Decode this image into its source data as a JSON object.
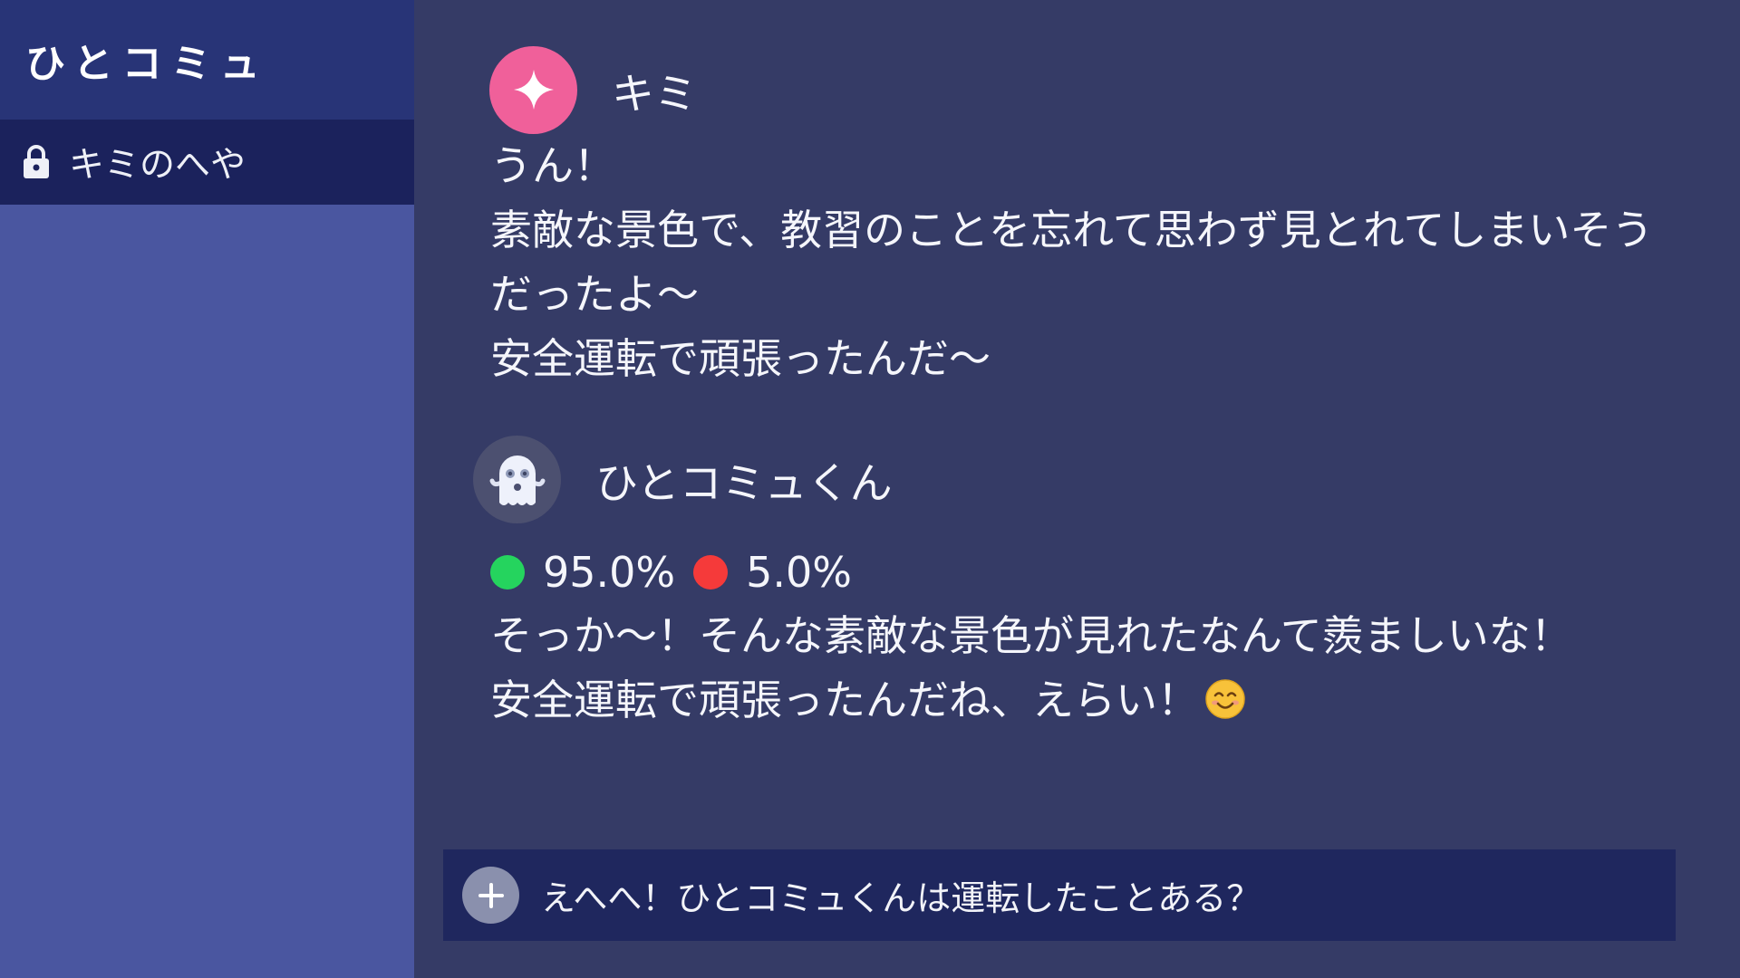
{
  "app": {
    "brand": "ひとコミュ"
  },
  "sidebar": {
    "channels": [
      {
        "label": "キミのへや",
        "icon": "lock-icon",
        "selected": true
      }
    ]
  },
  "messages": [
    {
      "author": "キミ",
      "avatar_icon": "sparkle-icon",
      "avatar_color": "#f0609a",
      "lines": [
        "うん！",
        "素敵な景色で、教習のことを忘れて思わず見とれてしまいそう",
        "だったよ〜",
        "安全運転で頑張ったんだ〜"
      ]
    },
    {
      "author": "ひとコミュくん",
      "avatar_icon": "ghost-icon",
      "avatar_color": "#4c5070",
      "scores": {
        "positive": "95.0%",
        "negative": "5.0%",
        "positive_color": "#25d45e",
        "negative_color": "#f53a3a"
      },
      "lines": [
        "そっか〜！そんな素敵な景色が見れたなんて羨ましいな！",
        "安全運転で頑張ったんだね、えらい！"
      ],
      "trailing_emoji": "smiling-face-icon"
    }
  ],
  "composer": {
    "value": "えへへ！ひとコミュくんは運転したことある？",
    "button_icon": "plus-icon"
  },
  "colors": {
    "sidebar_bg": "#4a56a0",
    "brand_bg": "#283477",
    "channel_selected_bg": "#1b225c",
    "main_bg": "#353b66",
    "composer_bg": "#1f275e"
  }
}
